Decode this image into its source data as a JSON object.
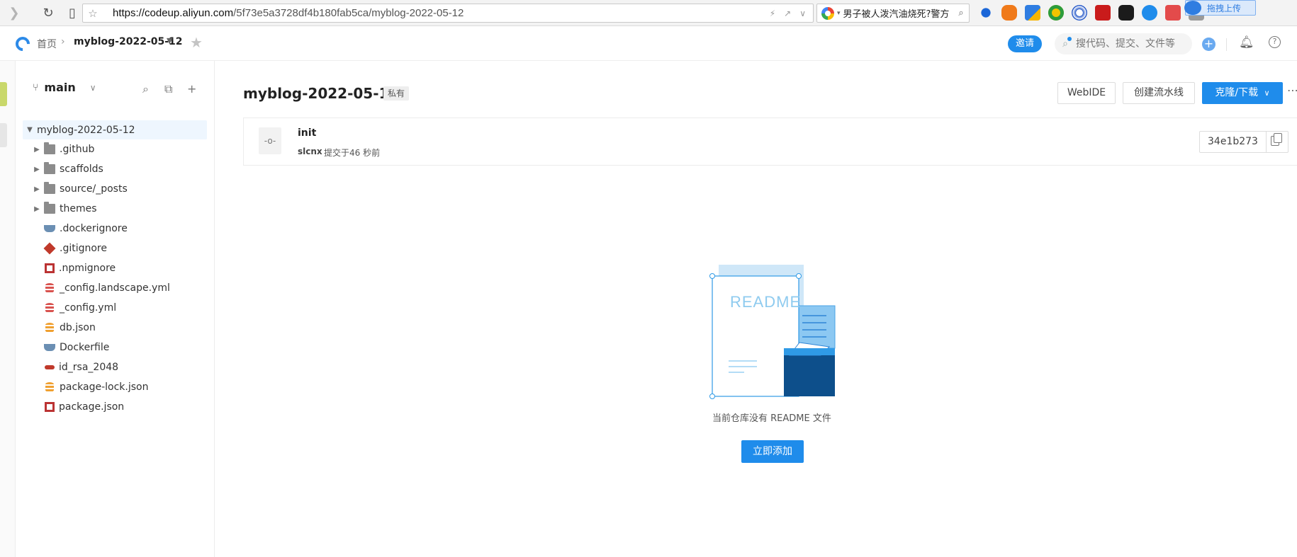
{
  "browser": {
    "url_host": "https://codeup.aliyun.com",
    "url_path": "/5f73e5a3728df4b180fab5ca/myblog-2022-05-12",
    "search_query": "男子被人泼汽油烧死?警方",
    "upload_chip_label": "拖拽上传"
  },
  "header": {
    "home": "首页",
    "repo": "myblog-2022-05-12",
    "invite": "邀请",
    "search_placeholder": "搜代码、提交、文件等"
  },
  "sidebar": {
    "branch": "main",
    "root": "myblog-2022-05-12",
    "items": [
      {
        "name": ".github",
        "type": "folder"
      },
      {
        "name": "scaffolds",
        "type": "folder"
      },
      {
        "name": "source/_posts",
        "type": "folder"
      },
      {
        "name": "themes",
        "type": "folder"
      },
      {
        "name": ".dockerignore",
        "type": "docker"
      },
      {
        "name": ".gitignore",
        "type": "git"
      },
      {
        "name": ".npmignore",
        "type": "npm"
      },
      {
        "name": "_config.landscape.yml",
        "type": "yml"
      },
      {
        "name": "_config.yml",
        "type": "yml"
      },
      {
        "name": "db.json",
        "type": "json"
      },
      {
        "name": "Dockerfile",
        "type": "docker"
      },
      {
        "name": "id_rsa_2048",
        "type": "key"
      },
      {
        "name": "package-lock.json",
        "type": "json"
      },
      {
        "name": "package.json",
        "type": "npm"
      }
    ]
  },
  "repo": {
    "title": "myblog-2022-05-12",
    "visibility": "私有",
    "actions": {
      "webide": "WebIDE",
      "pipeline": "创建流水线",
      "clone": "克隆/下载"
    }
  },
  "commit": {
    "message": "init",
    "author": "slcnx",
    "time": "提交于46 秒前",
    "sha": "34e1b273"
  },
  "empty_state": {
    "illustration_text": "README",
    "message": "当前仓库没有 README 文件",
    "add_button": "立即添加"
  },
  "colors": {
    "primary": "#1f8ceb",
    "tree_selected_bg": "#eef6fe",
    "readme_dark": "#0d4f8b"
  }
}
